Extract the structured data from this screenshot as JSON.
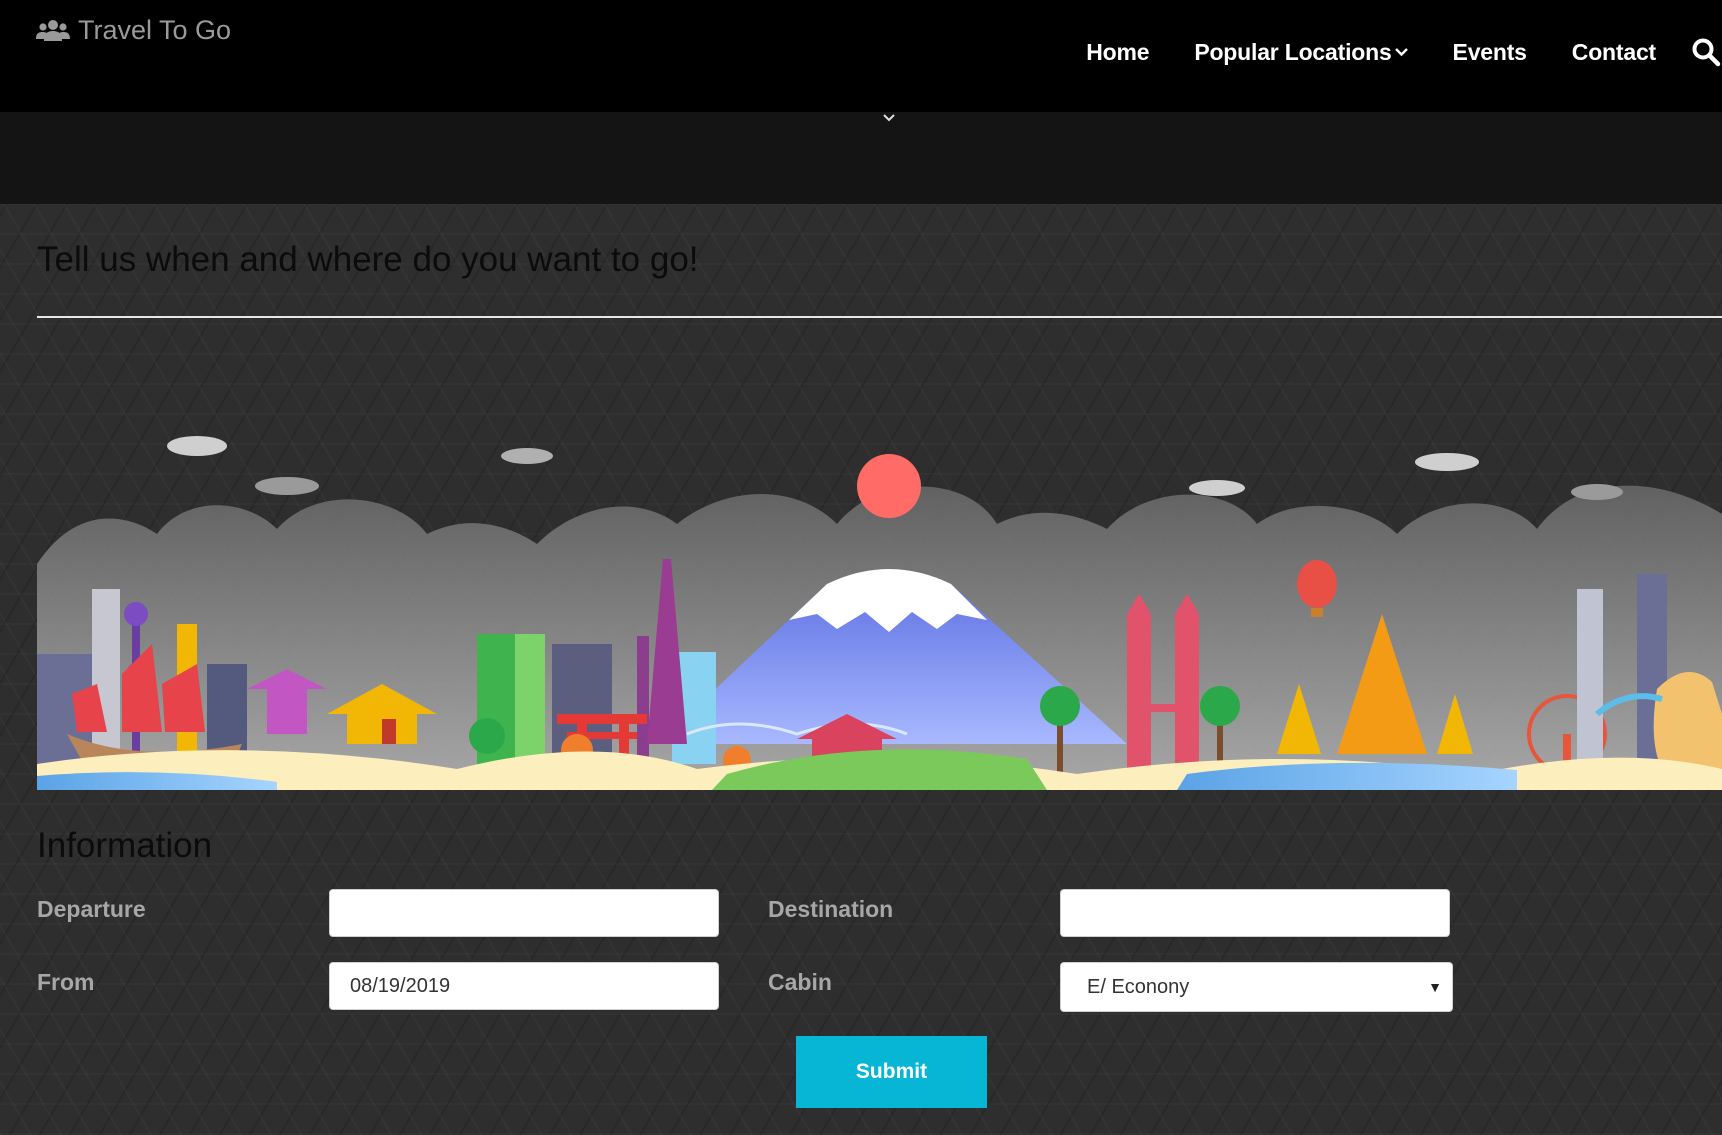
{
  "brand": {
    "name": "Travel To Go",
    "icon": "users-icon"
  },
  "nav": {
    "items": [
      {
        "label": "Home"
      },
      {
        "label": "Popular Locations",
        "icon": "chevron-down-icon"
      },
      {
        "label": "Events"
      },
      {
        "label": "Contact"
      }
    ],
    "search_icon": "search-icon"
  },
  "main": {
    "title": "Tell us when and where do you want to go!",
    "banner": {
      "icon": "asian-landmarks-skyline-illustration"
    }
  },
  "form": {
    "title": "Information",
    "departure": {
      "label": "Departure",
      "value": ""
    },
    "destination": {
      "label": "Destination",
      "value": ""
    },
    "from": {
      "label": "From",
      "value": "08/19/2019"
    },
    "cabin": {
      "label": "Cabin",
      "value": "E/ Econony"
    },
    "submit_label": "Submit"
  },
  "colors": {
    "navbar": "#000000",
    "background": "#2d2d2d",
    "accent": "#06b6d4",
    "label": "#a7a7a7"
  }
}
